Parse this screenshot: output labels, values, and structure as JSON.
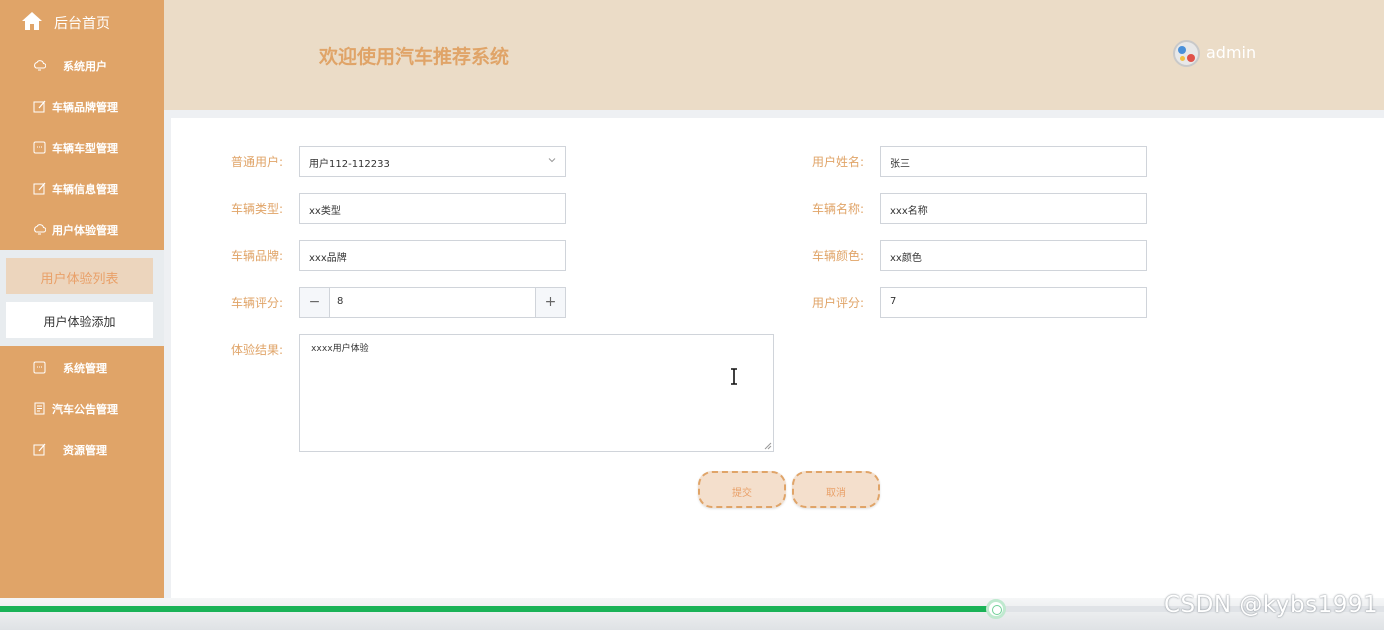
{
  "sidebar": {
    "home_label": "后台首页",
    "items": [
      {
        "label": "系统用户",
        "icon": "cloud-icon"
      },
      {
        "label": "车辆品牌管理",
        "icon": "edit-icon"
      },
      {
        "label": "车辆车型管理",
        "icon": "message-icon"
      },
      {
        "label": "车辆信息管理",
        "icon": "edit-icon"
      },
      {
        "label": "用户体验管理",
        "icon": "cloud-icon"
      },
      {
        "label": "系统管理",
        "icon": "message-icon"
      },
      {
        "label": "汽车公告管理",
        "icon": "document-icon"
      },
      {
        "label": "资源管理",
        "icon": "edit-icon"
      }
    ],
    "submenu": {
      "active": "用户体验列表",
      "item": "用户体验添加"
    }
  },
  "header": {
    "title": "欢迎使用汽车推荐系统",
    "username": "admin"
  },
  "form": {
    "user_label": "普通用户:",
    "user_value": "用户112-112233",
    "name_label": "用户姓名:",
    "name_value": "张三",
    "type_label": "车辆类型:",
    "type_value": "xx类型",
    "car_name_label": "车辆名称:",
    "car_name_value": "xxx名称",
    "brand_label": "车辆品牌:",
    "brand_value": "xxx品牌",
    "color_label": "车辆颜色:",
    "color_value": "xx颜色",
    "rating_label": "车辆评分:",
    "rating_value": "8",
    "rating_minus": "−",
    "rating_plus": "+",
    "user_rating_label": "用户评分:",
    "user_rating_value": "7",
    "result_label": "体验结果:",
    "result_value": "xxxx用户体验"
  },
  "buttons": {
    "submit": "提交",
    "cancel": "取消"
  },
  "video": {
    "progress": 0.72
  },
  "watermark": "CSDN @kybs1991",
  "colors": {
    "sidebar": "#e0a468",
    "header": "#ebdcc7",
    "accent": "#e0a468",
    "progress": "#19b257"
  }
}
